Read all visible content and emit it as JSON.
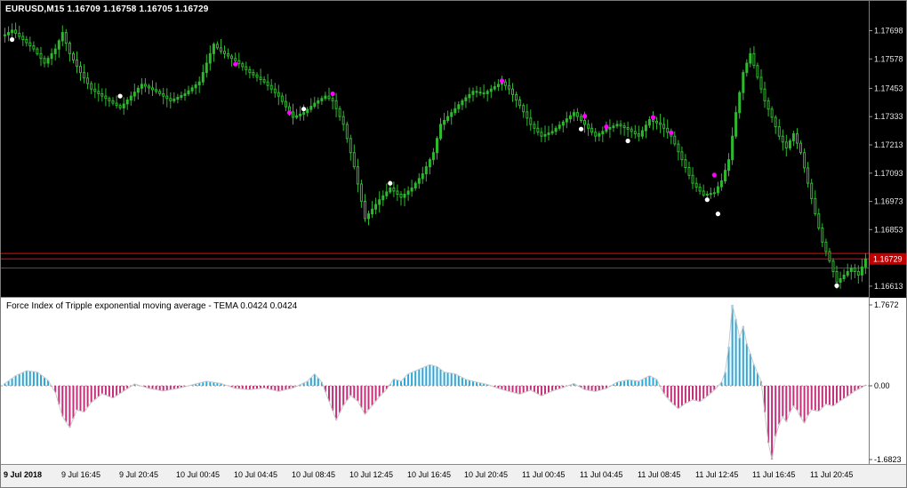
{
  "main_chart": {
    "title": "EURUSD,M15 1.16709 1.16758 1.16705 1.16729",
    "symbol": "EURUSD",
    "timeframe": "M15",
    "ohlc": {
      "open": "1.16709",
      "high": "1.16758",
      "low": "1.16705",
      "close": "1.16729"
    },
    "price_axis_labels": [
      "1.17698",
      "1.17578",
      "1.17453",
      "1.17333",
      "1.17213",
      "1.17093",
      "1.16973",
      "1.16853",
      "1.16613"
    ],
    "current_price": "1.16729"
  },
  "indicator": {
    "title": "Force Index of Tripple exponential moving average - TEMA 0.0424 0.0424",
    "name": "Force Index of Tripple exponential moving average - TEMA",
    "values": [
      "0.0424",
      "0.0424"
    ],
    "axis_labels": [
      "1.7672",
      "0.00",
      "-1.6823"
    ]
  },
  "time_axis": {
    "labels": [
      "9 Jul 2018",
      "9 Jul 16:45",
      "9 Jul 20:45",
      "10 Jul 00:45",
      "10 Jul 04:45",
      "10 Jul 08:45",
      "10 Jul 12:45",
      "10 Jul 16:45",
      "10 Jul 20:45",
      "11 Jul 00:45",
      "11 Jul 04:45",
      "11 Jul 08:45",
      "11 Jul 12:45",
      "11 Jul 16:45",
      "11 Jul 20:45"
    ]
  },
  "colors": {
    "background": "#000000",
    "candle": "#2eb82e",
    "magenta_dot": "#ff00ff",
    "white_dot": "#ffffff",
    "red_line": "#ff0000",
    "blue_line": "#3545c4",
    "positive_bar": "#29a8dc",
    "negative_bar": "#c13079",
    "envelope_line": "#c8c8c8",
    "zero_line": "#9b9b9b",
    "current_price_bg": "#c00000",
    "indicator_bg": "#ffffff",
    "axis_text_main": "#e4e4e4",
    "axis_text_ind": "#000000",
    "time_strip_bg": "#f0f0f0"
  },
  "chart_data": [
    {
      "type": "candlestick",
      "title": "EURUSD M15",
      "bars": 240,
      "price_range": [
        1.16575,
        1.1773
      ],
      "close_path_anchors": [
        [
          0,
          1.1768
        ],
        [
          2,
          1.177
        ],
        [
          5,
          1.1766
        ],
        [
          8,
          1.1762
        ],
        [
          11,
          1.1756
        ],
        [
          14,
          1.1762
        ],
        [
          16,
          1.1769
        ],
        [
          18,
          1.176
        ],
        [
          21,
          1.1752
        ],
        [
          24,
          1.1745
        ],
        [
          28,
          1.1741
        ],
        [
          32,
          1.1737
        ],
        [
          35,
          1.1742
        ],
        [
          38,
          1.1747
        ],
        [
          42,
          1.1744
        ],
        [
          46,
          1.174
        ],
        [
          50,
          1.1743
        ],
        [
          54,
          1.1748
        ],
        [
          58,
          1.1764
        ],
        [
          60,
          1.1761
        ],
        [
          64,
          1.1757
        ],
        [
          68,
          1.1752
        ],
        [
          72,
          1.1748
        ],
        [
          76,
          1.1742
        ],
        [
          80,
          1.1733
        ],
        [
          83,
          1.1735
        ],
        [
          86,
          1.1739
        ],
        [
          89,
          1.1742
        ],
        [
          91,
          1.174
        ],
        [
          94,
          1.173
        ],
        [
          97,
          1.1712
        ],
        [
          100,
          1.169
        ],
        [
          102,
          1.1694
        ],
        [
          104,
          1.1698
        ],
        [
          107,
          1.1703
        ],
        [
          110,
          1.1699
        ],
        [
          113,
          1.1703
        ],
        [
          116,
          1.1709
        ],
        [
          119,
          1.1718
        ],
        [
          121,
          1.173
        ],
        [
          124,
          1.1735
        ],
        [
          127,
          1.174
        ],
        [
          130,
          1.1744
        ],
        [
          133,
          1.1743
        ],
        [
          136,
          1.1746
        ],
        [
          138,
          1.1748
        ],
        [
          140,
          1.1745
        ],
        [
          143,
          1.1738
        ],
        [
          146,
          1.173
        ],
        [
          149,
          1.1725
        ],
        [
          152,
          1.1727
        ],
        [
          155,
          1.1731
        ],
        [
          158,
          1.1735
        ],
        [
          161,
          1.173
        ],
        [
          164,
          1.1725
        ],
        [
          167,
          1.1728
        ],
        [
          170,
          1.173
        ],
        [
          173,
          1.1728
        ],
        [
          176,
          1.1725
        ],
        [
          179,
          1.1732
        ],
        [
          182,
          1.173
        ],
        [
          185,
          1.1725
        ],
        [
          188,
          1.1715
        ],
        [
          191,
          1.1705
        ],
        [
          194,
          1.17
        ],
        [
          197,
          1.1701
        ],
        [
          199,
          1.1706
        ],
        [
          201,
          1.1715
        ],
        [
          203,
          1.1735
        ],
        [
          205,
          1.1752
        ],
        [
          207,
          1.176
        ],
        [
          209,
          1.175
        ],
        [
          211,
          1.174
        ],
        [
          213,
          1.1733
        ],
        [
          215,
          1.1725
        ],
        [
          217,
          1.172
        ],
        [
          219,
          1.1726
        ],
        [
          221,
          1.1718
        ],
        [
          223,
          1.1705
        ],
        [
          225,
          1.1692
        ],
        [
          227,
          1.168
        ],
        [
          229,
          1.1672
        ],
        [
          231,
          1.1663
        ],
        [
          233,
          1.1666
        ],
        [
          235,
          1.1669
        ],
        [
          237,
          1.1666
        ],
        [
          239,
          1.16729
        ]
      ],
      "signal_dots": [
        {
          "i": 2,
          "price": 1.1766,
          "color": "white"
        },
        {
          "i": 32,
          "price": 1.1742,
          "color": "white"
        },
        {
          "i": 83,
          "price": 1.17365,
          "color": "white"
        },
        {
          "i": 107,
          "price": 1.1705,
          "color": "white"
        },
        {
          "i": 160,
          "price": 1.1728,
          "color": "white"
        },
        {
          "i": 173,
          "price": 1.1723,
          "color": "white"
        },
        {
          "i": 195,
          "price": 1.1698,
          "color": "white"
        },
        {
          "i": 198,
          "price": 1.1692,
          "color": "white"
        },
        {
          "i": 231,
          "price": 1.16615,
          "color": "white"
        },
        {
          "i": 64,
          "price": 1.17556,
          "color": "magenta"
        },
        {
          "i": 79,
          "price": 1.1735,
          "color": "magenta"
        },
        {
          "i": 91,
          "price": 1.1743,
          "color": "magenta"
        },
        {
          "i": 138,
          "price": 1.17485,
          "color": "magenta"
        },
        {
          "i": 161,
          "price": 1.17335,
          "color": "magenta"
        },
        {
          "i": 167,
          "price": 1.1729,
          "color": "magenta"
        },
        {
          "i": 180,
          "price": 1.1733,
          "color": "magenta"
        },
        {
          "i": 185,
          "price": 1.17265,
          "color": "magenta"
        },
        {
          "i": 197,
          "price": 1.17085,
          "color": "magenta"
        }
      ],
      "hlines": [
        {
          "price": 1.16752,
          "color": "#ff0000"
        },
        {
          "price": 1.16729,
          "color": "#ff0000"
        },
        {
          "price": 1.1669,
          "color": "#3545c4"
        }
      ]
    },
    {
      "type": "bar",
      "title": "Force Index of Tripple exponential moving average - TEMA",
      "bars": 240,
      "ylim": [
        -1.6823,
        1.7672
      ],
      "zero_line": true,
      "values_anchors": [
        [
          0,
          0.05
        ],
        [
          3,
          0.22
        ],
        [
          6,
          0.33
        ],
        [
          9,
          0.3
        ],
        [
          12,
          0.12
        ],
        [
          14,
          -0.15
        ],
        [
          16,
          -0.7
        ],
        [
          18,
          -0.95
        ],
        [
          20,
          -0.55
        ],
        [
          22,
          -0.6
        ],
        [
          24,
          -0.38
        ],
        [
          27,
          -0.18
        ],
        [
          30,
          -0.28
        ],
        [
          33,
          -0.12
        ],
        [
          36,
          0.04
        ],
        [
          40,
          -0.06
        ],
        [
          44,
          -0.12
        ],
        [
          48,
          -0.06
        ],
        [
          52,
          0.02
        ],
        [
          56,
          0.1
        ],
        [
          60,
          0.05
        ],
        [
          64,
          -0.06
        ],
        [
          68,
          -0.09
        ],
        [
          72,
          -0.05
        ],
        [
          76,
          -0.13
        ],
        [
          80,
          -0.05
        ],
        [
          84,
          0.1
        ],
        [
          86,
          0.26
        ],
        [
          88,
          0.08
        ],
        [
          90,
          -0.35
        ],
        [
          92,
          -0.78
        ],
        [
          94,
          -0.45
        ],
        [
          96,
          -0.22
        ],
        [
          98,
          -0.35
        ],
        [
          100,
          -0.65
        ],
        [
          102,
          -0.45
        ],
        [
          104,
          -0.25
        ],
        [
          106,
          -0.08
        ],
        [
          108,
          0.15
        ],
        [
          110,
          0.1
        ],
        [
          112,
          0.26
        ],
        [
          115,
          0.36
        ],
        [
          118,
          0.46
        ],
        [
          120,
          0.42
        ],
        [
          122,
          0.3
        ],
        [
          125,
          0.26
        ],
        [
          128,
          0.14
        ],
        [
          131,
          0.08
        ],
        [
          134,
          0.03
        ],
        [
          137,
          -0.06
        ],
        [
          140,
          -0.13
        ],
        [
          143,
          -0.19
        ],
        [
          146,
          -0.1
        ],
        [
          149,
          -0.23
        ],
        [
          152,
          -0.12
        ],
        [
          155,
          -0.04
        ],
        [
          158,
          0.05
        ],
        [
          161,
          -0.09
        ],
        [
          164,
          -0.13
        ],
        [
          167,
          -0.06
        ],
        [
          170,
          0.08
        ],
        [
          173,
          0.13
        ],
        [
          176,
          0.1
        ],
        [
          179,
          0.22
        ],
        [
          181,
          0.14
        ],
        [
          183,
          -0.18
        ],
        [
          185,
          -0.38
        ],
        [
          187,
          -0.52
        ],
        [
          189,
          -0.4
        ],
        [
          191,
          -0.32
        ],
        [
          193,
          -0.36
        ],
        [
          195,
          -0.24
        ],
        [
          197,
          -0.1
        ],
        [
          199,
          0.08
        ],
        [
          200,
          0.3
        ],
        [
          201,
          0.85
        ],
        [
          202,
          1.7672
        ],
        [
          203,
          1.45
        ],
        [
          204,
          1.05
        ],
        [
          205,
          1.3
        ],
        [
          206,
          0.92
        ],
        [
          207,
          0.7
        ],
        [
          208,
          0.46
        ],
        [
          209,
          0.28
        ],
        [
          210,
          0.1
        ],
        [
          211,
          -0.6
        ],
        [
          212,
          -1.3
        ],
        [
          213,
          -1.6823
        ],
        [
          214,
          -1.15
        ],
        [
          215,
          -0.88
        ],
        [
          216,
          -0.7
        ],
        [
          217,
          -0.82
        ],
        [
          218,
          -0.6
        ],
        [
          219,
          -0.46
        ],
        [
          220,
          -0.56
        ],
        [
          221,
          -0.72
        ],
        [
          222,
          -0.85
        ],
        [
          223,
          -0.68
        ],
        [
          224,
          -0.55
        ],
        [
          226,
          -0.58
        ],
        [
          228,
          -0.42
        ],
        [
          230,
          -0.46
        ],
        [
          232,
          -0.34
        ],
        [
          234,
          -0.24
        ],
        [
          236,
          -0.12
        ],
        [
          238,
          -0.04
        ],
        [
          239,
          0.02
        ]
      ]
    }
  ]
}
